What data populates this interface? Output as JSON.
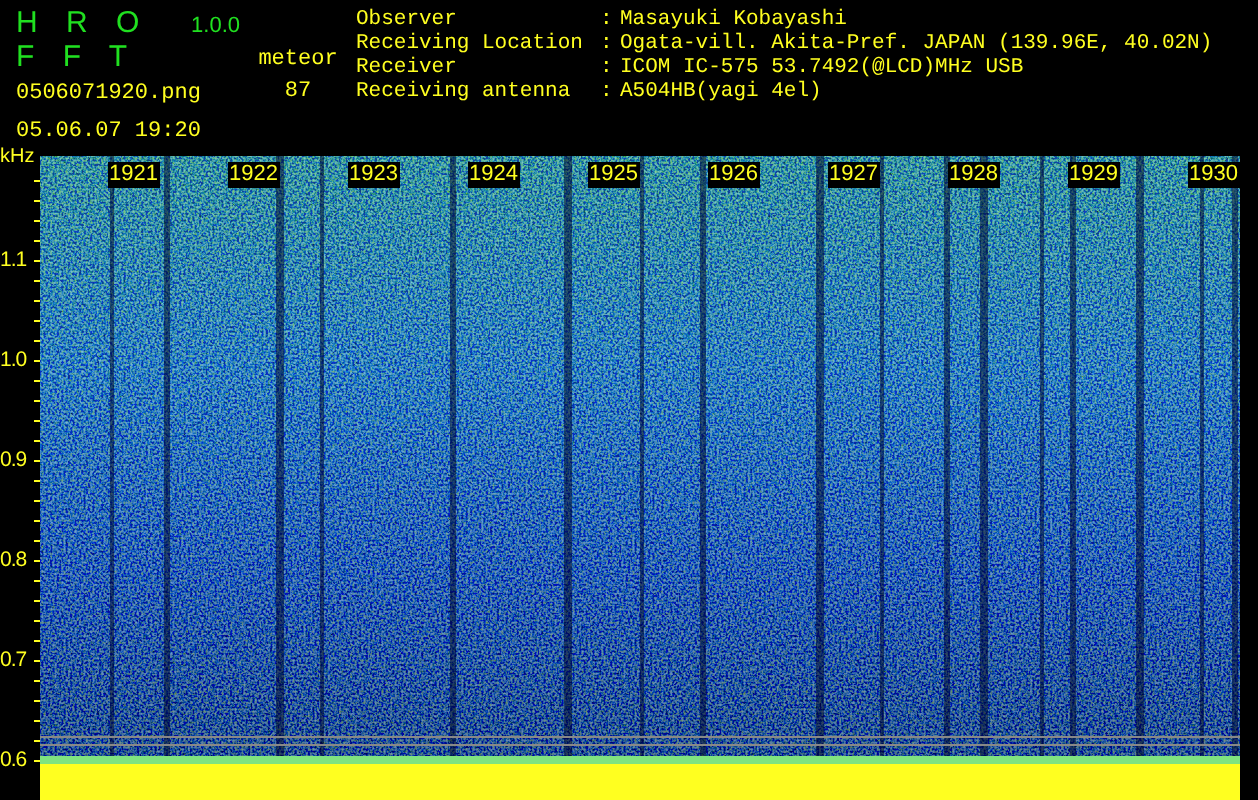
{
  "app": {
    "name": "H R O F F T",
    "version": "1.0.0"
  },
  "file": {
    "name": "0506071920.png",
    "datetime": "05.06.07 19:20"
  },
  "meteor": {
    "label": "meteor",
    "count": "87"
  },
  "station": [
    {
      "label": "Observer",
      "separator": ":",
      "value": "Masayuki Kobayashi"
    },
    {
      "label": "Receiving Location",
      "separator": ":",
      "value": "Ogata-vill. Akita-Pref. JAPAN (139.96E, 40.02N)"
    },
    {
      "label": "Receiver",
      "separator": ":",
      "value": "ICOM IC-575 53.7492(@LCD)MHz USB"
    },
    {
      "label": "Receiving antenna",
      "separator": ":",
      "value": "A504HB(yagi 4el)"
    }
  ],
  "spectrogram": {
    "unit": "kHz",
    "time_labels": [
      "1921",
      "1922",
      "1923",
      "1924",
      "1925",
      "1926",
      "1927",
      "1928",
      "1929",
      "1930"
    ],
    "frequency_labels": [
      "1.1",
      "1.0",
      "0.9",
      "0.8",
      "0.7",
      "0.6"
    ]
  }
}
